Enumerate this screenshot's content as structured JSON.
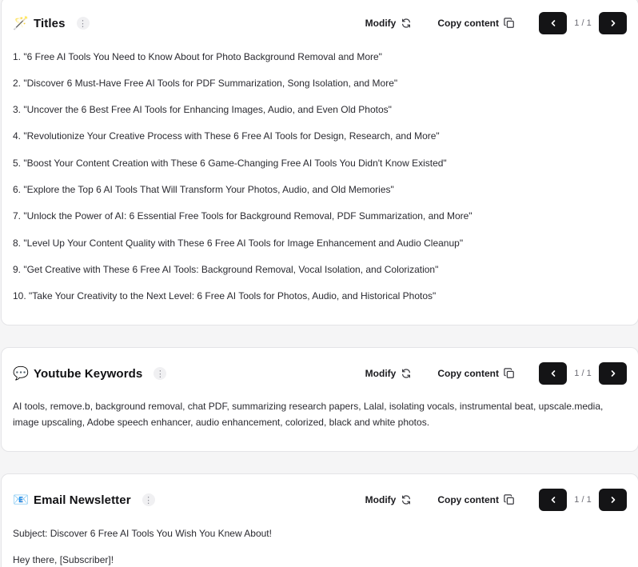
{
  "titles_card": {
    "emoji": "🪄",
    "title": "Titles",
    "modify_label": "Modify",
    "copy_label": "Copy content",
    "page_indicator": "1 / 1",
    "items": [
      "1. \"6 Free AI Tools You Need to Know About for Photo Background Removal and More\"",
      "2. \"Discover 6 Must-Have Free AI Tools for PDF Summarization, Song Isolation, and More\"",
      "3. \"Uncover the 6 Best Free AI Tools for Enhancing Images, Audio, and Even Old Photos\"",
      "4. \"Revolutionize Your Creative Process with These 6 Free AI Tools for Design, Research, and More\"",
      "5. \"Boost Your Content Creation with These 6 Game-Changing Free AI Tools You Didn't Know Existed\"",
      "6. \"Explore the Top 6 AI Tools That Will Transform Your Photos, Audio, and Old Memories\"",
      "7. \"Unlock the Power of AI: 6 Essential Free Tools for Background Removal, PDF Summarization, and More\"",
      "8. \"Level Up Your Content Quality with These 6 Free AI Tools for Image Enhancement and Audio Cleanup\"",
      "9. \"Get Creative with These 6 Free AI Tools: Background Removal, Vocal Isolation, and Colorization\"",
      "10. \"Take Your Creativity to the Next Level: 6 Free AI Tools for Photos, Audio, and Historical Photos\""
    ]
  },
  "keywords_card": {
    "emoji": "💬",
    "title": "Youtube Keywords",
    "modify_label": "Modify",
    "copy_label": "Copy content",
    "page_indicator": "1 / 1",
    "text": "AI tools, remove.b, background removal, chat PDF, summarizing research papers, Lalal, isolating vocals, instrumental beat, upscale.media, image upscaling, Adobe speech enhancer, audio enhancement, colorized, black and white photos."
  },
  "newsletter_card": {
    "emoji": "📧",
    "title": "Email Newsletter",
    "modify_label": "Modify",
    "copy_label": "Copy content",
    "page_indicator": "1 / 1",
    "lines": [
      "Subject: Discover 6 Free AI Tools You Wish You Knew About!",
      "Hey there, [Subscriber]!"
    ]
  },
  "icons": {
    "menu": "kebab-icon",
    "modify": "refresh-icon",
    "copy": "copy-icon",
    "prev": "chevron-left-icon",
    "next": "chevron-right-icon"
  },
  "colors": {
    "page_bg": "#f5f5f6",
    "card_bg": "#ffffff",
    "pager_button": "#141416"
  }
}
